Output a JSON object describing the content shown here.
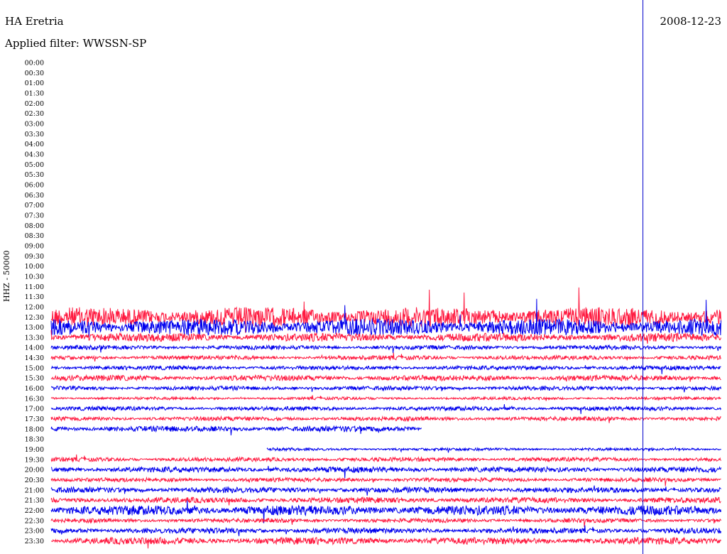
{
  "header": {
    "station": "HA Eretria",
    "filter": "Applied filter: WWSSN-SP",
    "date": "2008-12-23"
  },
  "chart_data": {
    "type": "line",
    "title": "HA Eretria",
    "subtitle": "Applied filter: WWSSN-SP",
    "ylabel": "HHZ - 50000",
    "y_ticks": [
      "00:00",
      "00:30",
      "01:00",
      "01:30",
      "02:00",
      "02:30",
      "03:00",
      "03:30",
      "04:00",
      "04:30",
      "05:00",
      "05:30",
      "06:00",
      "06:30",
      "07:00",
      "07:30",
      "08:00",
      "08:30",
      "09:00",
      "09:30",
      "10:00",
      "10:30",
      "11:00",
      "11:30",
      "12:00",
      "12:30",
      "13:00",
      "13:30",
      "14:00",
      "14:30",
      "15:00",
      "15:30",
      "16:00",
      "16:30",
      "17:00",
      "17:30",
      "18:00",
      "18:30",
      "19:00",
      "19:30",
      "20:00",
      "20:30",
      "21:00",
      "21:30",
      "22:00",
      "22:30",
      "23:00",
      "23:30"
    ],
    "series_colors": [
      "#ff1a40",
      "#0000ee"
    ],
    "marker_color": "#0000cc",
    "marker_fraction": 0.883,
    "traces": [
      {
        "row": "12:30",
        "color": "#ff1a40",
        "start": 0.0,
        "end": 1.0,
        "amp": 14
      },
      {
        "row": "13:00",
        "color": "#0000ee",
        "start": 0.0,
        "end": 1.0,
        "amp": 12
      },
      {
        "row": "13:30",
        "color": "#ff1a40",
        "start": 0.0,
        "end": 1.0,
        "amp": 6
      },
      {
        "row": "14:00",
        "color": "#0000ee",
        "start": 0.0,
        "end": 1.0,
        "amp": 3
      },
      {
        "row": "14:30",
        "color": "#ff1a40",
        "start": 0.0,
        "end": 1.0,
        "amp": 3
      },
      {
        "row": "15:00",
        "color": "#0000ee",
        "start": 0.0,
        "end": 1.0,
        "amp": 3
      },
      {
        "row": "15:30",
        "color": "#ff1a40",
        "start": 0.0,
        "end": 1.0,
        "amp": 4
      },
      {
        "row": "16:00",
        "color": "#0000ee",
        "start": 0.0,
        "end": 1.0,
        "amp": 3
      },
      {
        "row": "16:30",
        "color": "#ff1a40",
        "start": 0.0,
        "end": 1.0,
        "amp": 2
      },
      {
        "row": "17:00",
        "color": "#0000ee",
        "start": 0.0,
        "end": 1.0,
        "amp": 3
      },
      {
        "row": "17:30",
        "color": "#ff1a40",
        "start": 0.0,
        "end": 1.0,
        "amp": 3
      },
      {
        "row": "18:00",
        "color": "#0000ee",
        "start": 0.0,
        "end": 0.553,
        "amp": 4
      },
      {
        "row": "19:00",
        "color": "#0000ee",
        "start": 0.322,
        "end": 1.0,
        "amp": 2
      },
      {
        "row": "19:30",
        "color": "#ff1a40",
        "start": 0.0,
        "end": 1.0,
        "amp": 3
      },
      {
        "row": "20:00",
        "color": "#0000ee",
        "start": 0.0,
        "end": 1.0,
        "amp": 4
      },
      {
        "row": "20:30",
        "color": "#ff1a40",
        "start": 0.0,
        "end": 1.0,
        "amp": 3
      },
      {
        "row": "21:00",
        "color": "#0000ee",
        "start": 0.0,
        "end": 1.0,
        "amp": 4
      },
      {
        "row": "21:30",
        "color": "#ff1a40",
        "start": 0.0,
        "end": 1.0,
        "amp": 4
      },
      {
        "row": "22:00",
        "color": "#0000ee",
        "start": 0.0,
        "end": 1.0,
        "amp": 7
      },
      {
        "row": "22:30",
        "color": "#ff1a40",
        "start": 0.0,
        "end": 1.0,
        "amp": 3
      },
      {
        "row": "23:00",
        "color": "#0000ee",
        "start": 0.0,
        "end": 1.0,
        "amp": 4
      },
      {
        "row": "23:30",
        "color": "#ff1a40",
        "start": 0.0,
        "end": 1.0,
        "amp": 5
      }
    ]
  }
}
